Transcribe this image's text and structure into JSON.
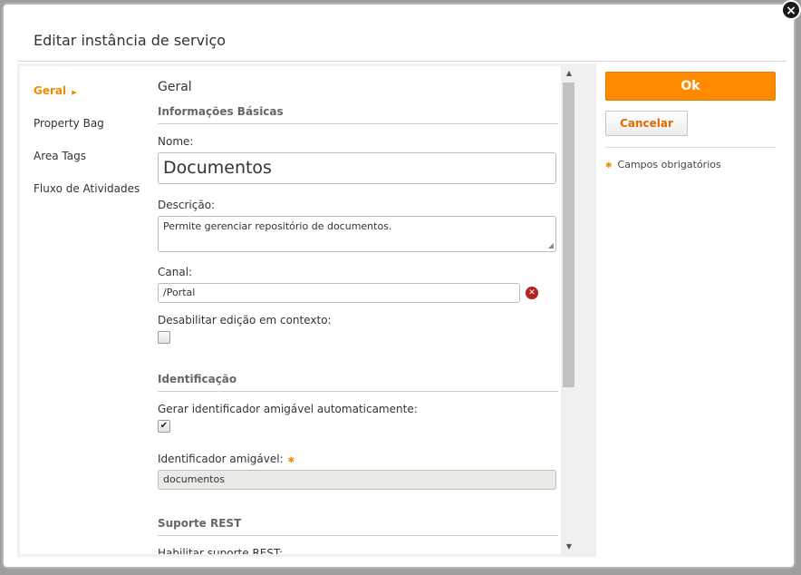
{
  "dialog": {
    "title": "Editar instância de serviço",
    "close_label": "×"
  },
  "nav": {
    "items": [
      {
        "label": "Geral",
        "active": true
      },
      {
        "label": "Property Bag"
      },
      {
        "label": "Area Tags"
      },
      {
        "label": "Fluxo de Atividades"
      }
    ]
  },
  "content": {
    "heading": "Geral",
    "basic": {
      "header": "Informações Básicas",
      "name_label": "Nome:",
      "name_value": "Documentos",
      "desc_label": "Descrição:",
      "desc_value": "Permite gerenciar repositório de documentos.",
      "canal_label": "Canal:",
      "canal_value": "/Portal",
      "disable_label": "Desabilitar edição em contexto:"
    },
    "ident": {
      "header": "Identificação",
      "auto_label": "Gerar identificador amigável automaticamente:",
      "auto_checked": "✔",
      "friendly_label": "Identificador amigável:",
      "friendly_value": "documentos"
    },
    "rest": {
      "header": "Suporte REST",
      "enable_label": "Habilitar suporte REST:"
    }
  },
  "actions": {
    "ok_label": "Ok",
    "cancel_label": "Cancelar",
    "required_note": "Campos obrigatórios"
  },
  "colors": {
    "accent": "#ff8a00",
    "remove": "#b52222"
  }
}
